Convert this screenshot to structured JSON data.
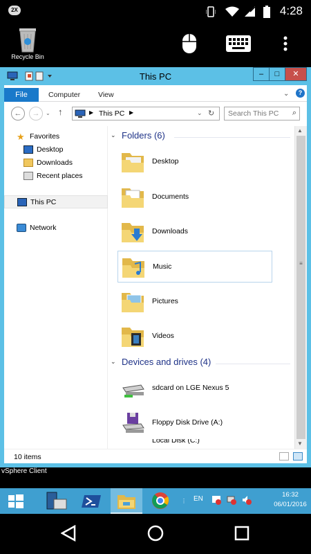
{
  "status_bar": {
    "badge": "2X",
    "time": "4:28"
  },
  "desktop": {
    "recycle_bin_label": "Recycle Bin"
  },
  "window": {
    "title": "This PC",
    "ribbon_tabs": [
      "File",
      "Computer",
      "View"
    ],
    "address": {
      "path": "This PC",
      "search_placeholder": "Search This PC"
    },
    "nav_pane": {
      "favorites": "Favorites",
      "favorites_items": [
        "Desktop",
        "Downloads",
        "Recent places"
      ],
      "this_pc": "This PC",
      "network": "Network"
    },
    "groups": {
      "folders": "Folders (6)",
      "devices": "Devices and drives (4)"
    },
    "folders": [
      "Desktop",
      "Documents",
      "Downloads",
      "Music",
      "Pictures",
      "Videos"
    ],
    "selected_folder": "Music",
    "devices": [
      "sdcard on LGE Nexus 5",
      "Floppy Disk Drive (A:)",
      "Local Disk (C:)"
    ],
    "status": "10 items"
  },
  "taskbar": {
    "background_app_label": "vSphere Client",
    "lang": "EN",
    "time": "16:32",
    "date": "06/01/2016",
    "colors": {
      "taskbar": "#3f9fd0",
      "accent": "#5cc0e6"
    }
  }
}
